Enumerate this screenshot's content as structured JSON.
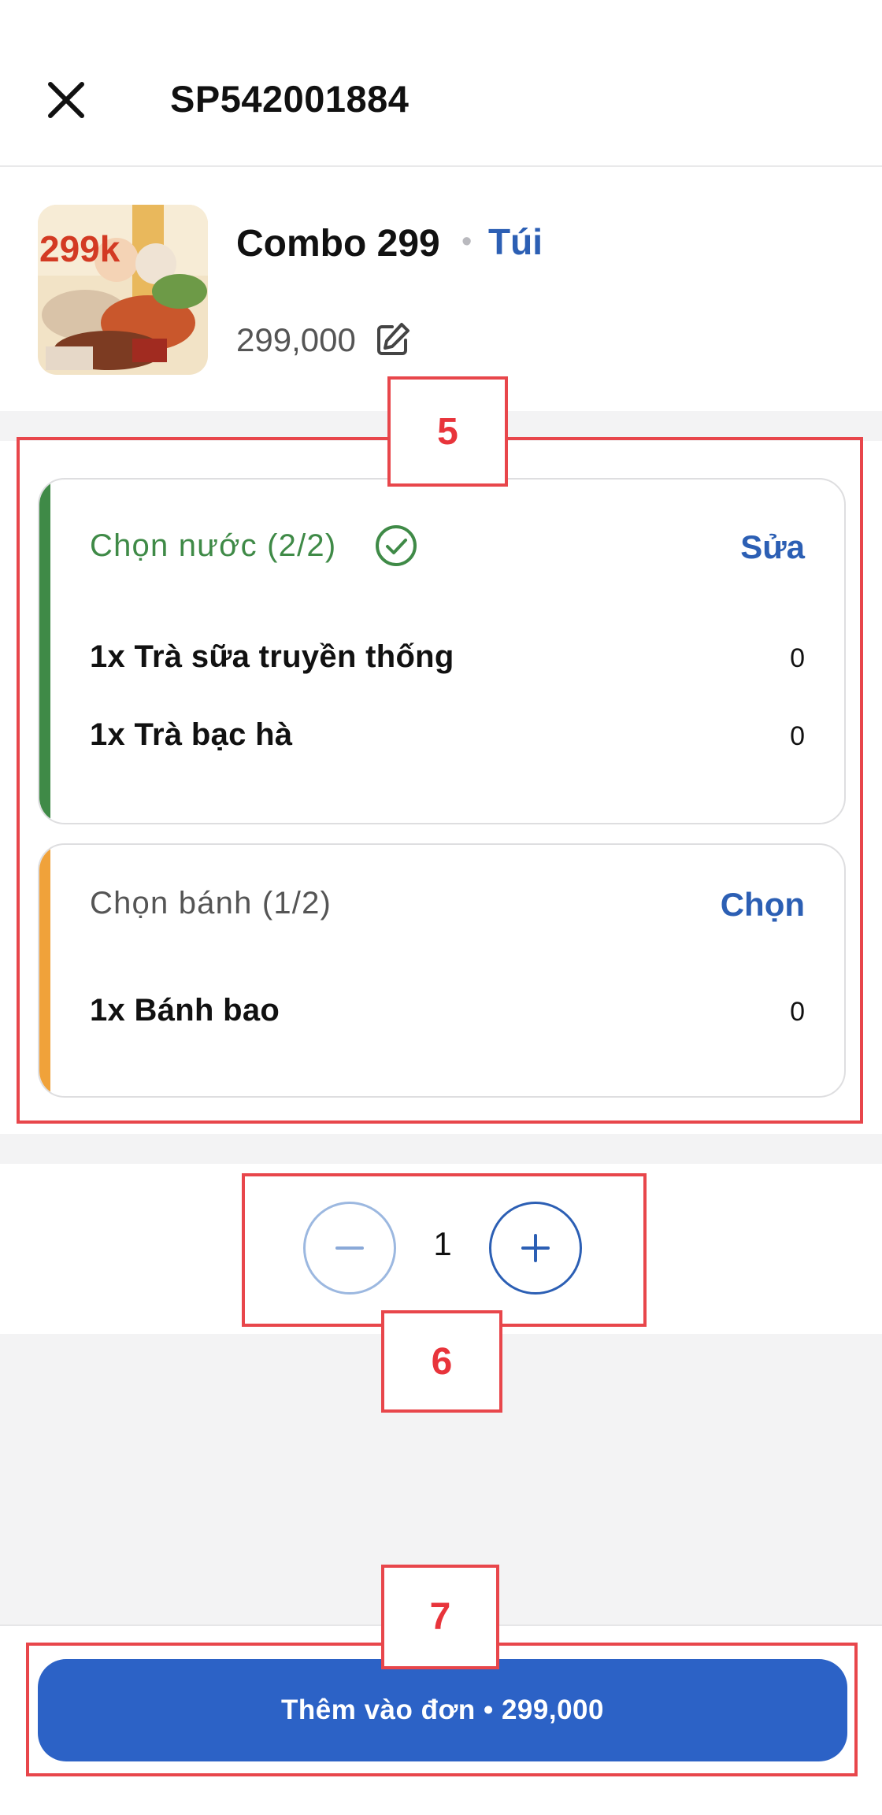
{
  "header": {
    "title": "SP542001884",
    "close_icon": "close-icon"
  },
  "product": {
    "name": "Combo 299",
    "separator": "•",
    "tag": "Túi",
    "price": "299,000",
    "edit_icon": "edit-icon",
    "image_text": "299k"
  },
  "groups": [
    {
      "title": "Chọn nước (2/2)",
      "action": "Sửa",
      "status_icon": "check-circle-icon",
      "accent_color": "#3f8a47",
      "items": [
        {
          "name": "1x Trà sữa truyền thống",
          "price": "0"
        },
        {
          "name": "1x Trà bạc hà",
          "price": "0"
        }
      ]
    },
    {
      "title": "Chọn bánh (1/2)",
      "action": "Chọn",
      "accent_color": "#f0a23a",
      "items": [
        {
          "name": "1x Bánh bao",
          "price": "0"
        }
      ]
    }
  ],
  "stepper": {
    "quantity": "1",
    "minus_icon": "minus-icon",
    "plus_icon": "plus-icon"
  },
  "footer": {
    "add_button": "Thêm vào đơn • 299,000"
  },
  "annotations": {
    "a5": "5",
    "a6": "6",
    "a7": "7"
  },
  "colors": {
    "brand": "#2c62c6",
    "success": "#3f8a47",
    "warning": "#f0a23a",
    "annotation": "#e8464b"
  }
}
